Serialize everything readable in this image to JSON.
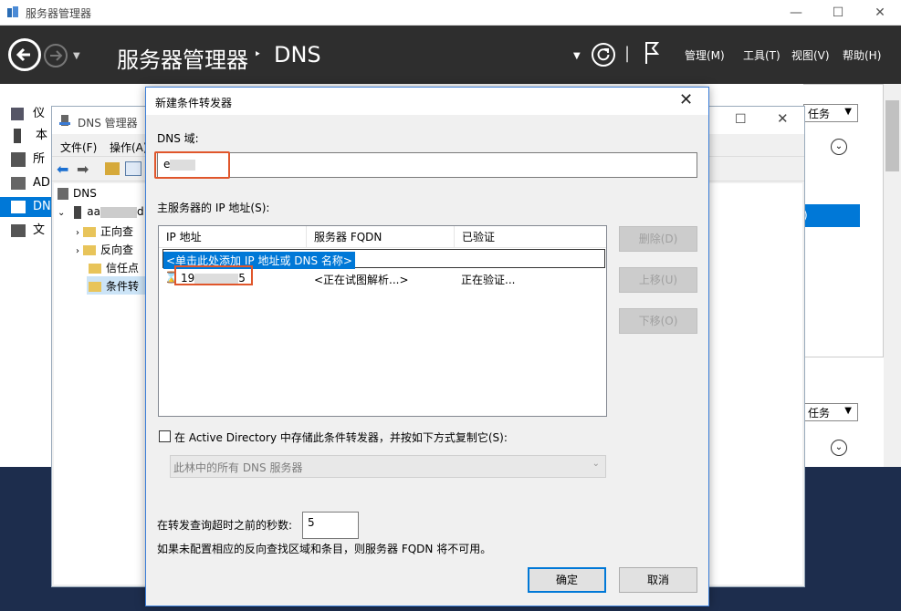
{
  "outer": {
    "title": "服务器管理器",
    "header_title": "服务器管理器",
    "header_sep": "‣",
    "header_sub": "DNS",
    "menus": [
      "管理(M)",
      "工具(T)",
      "视图(V)",
      "帮助(H)"
    ],
    "sidebar": [
      "仪",
      "本",
      "所",
      "AD",
      "DN",
      "文"
    ],
    "tasks": [
      "任务",
      "任务"
    ],
    "right_fragment": ")"
  },
  "dns_manager": {
    "title": "DNS 管理器",
    "menus": [
      "文件(F)",
      "操作(A)"
    ],
    "tree": {
      "root": "DNS",
      "server": "aa",
      "server_suffix": "d",
      "children": [
        "正向查",
        "反向查",
        "信任点",
        "条件转"
      ]
    }
  },
  "dialog": {
    "title": "新建条件转发器",
    "domain_label": "DNS 域:",
    "domain_value": "e",
    "ip_label": "主服务器的 IP 地址(S):",
    "columns": [
      "IP 地址",
      "服务器 FQDN",
      "已验证"
    ],
    "add_row": "<单击此处添加 IP 地址或 DNS 名称>",
    "rows": [
      {
        "ip": "19",
        "ip_tail": "5",
        "fqdn": "<正在试图解析...>",
        "validated": "正在验证..."
      }
    ],
    "side_buttons": [
      "删除(D)",
      "上移(U)",
      "下移(O)"
    ],
    "store_ad_label": "在 Active Directory 中存储此条件转发器，并按如下方式复制它(S):",
    "replication_value": "此林中的所有 DNS 服务器",
    "timeout_label": "在转发查询超时之前的秒数:",
    "timeout_value": "5",
    "note": "如果未配置相应的反向查找区域和条目，则服务器 FQDN 将不可用。",
    "ok": "确定",
    "cancel": "取消"
  },
  "colors": {
    "accent": "#0078d7",
    "highlight_box": "#e0562b",
    "header_bg": "#2e2e2e"
  }
}
